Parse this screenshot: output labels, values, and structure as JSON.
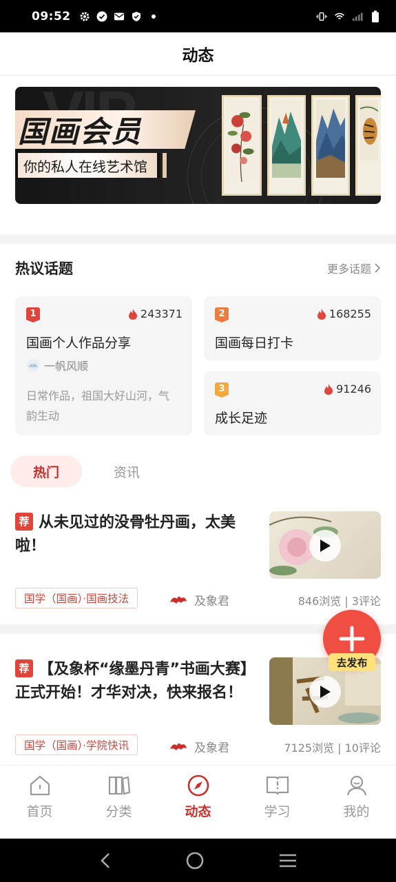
{
  "status": {
    "time": "09:52"
  },
  "header": {
    "title": "动态"
  },
  "banner": {
    "title": "国画会员",
    "subtitle": "你的私人在线艺术馆"
  },
  "topics": {
    "heading": "热议话题",
    "more": "更多话题",
    "items": [
      {
        "rank": "1",
        "heat": "243371",
        "title": "国画个人作品分享",
        "author": "一帆风顺",
        "desc": "日常作品，祖国大好山河，气韵生动",
        "color": "#e0453b"
      },
      {
        "rank": "2",
        "heat": "168255",
        "title": "国画每日打卡",
        "color": "#ef7b3f"
      },
      {
        "rank": "3",
        "heat": "91246",
        "title": "成长足迹",
        "color": "#f3a83b"
      }
    ]
  },
  "tabs": {
    "hot": "热门",
    "news": "资讯"
  },
  "posts": [
    {
      "badge": "荐",
      "title": "从未见过的没骨牡丹画，太美啦！",
      "tag": "国学（国画）·国画技法",
      "publisher": "及象君",
      "stats": "846浏览 | 3评论"
    },
    {
      "badge": "荐",
      "title": "【及象杯“缘墨丹青”书画大赛】正式开始！才华对决，快来报名！",
      "tag": "国学（国画）·学院快讯",
      "publisher": "及象君",
      "stats": "7125浏览 | 10评论"
    }
  ],
  "fab": {
    "label": "去发布"
  },
  "tabbar": [
    {
      "label": "首页",
      "icon": "home-icon"
    },
    {
      "label": "分类",
      "icon": "category-icon"
    },
    {
      "label": "动态",
      "icon": "compass-icon"
    },
    {
      "label": "学习",
      "icon": "book-icon"
    },
    {
      "label": "我的",
      "icon": "profile-icon"
    }
  ],
  "colors": {
    "accent": "#c9302c",
    "fab": "#f04e43"
  }
}
